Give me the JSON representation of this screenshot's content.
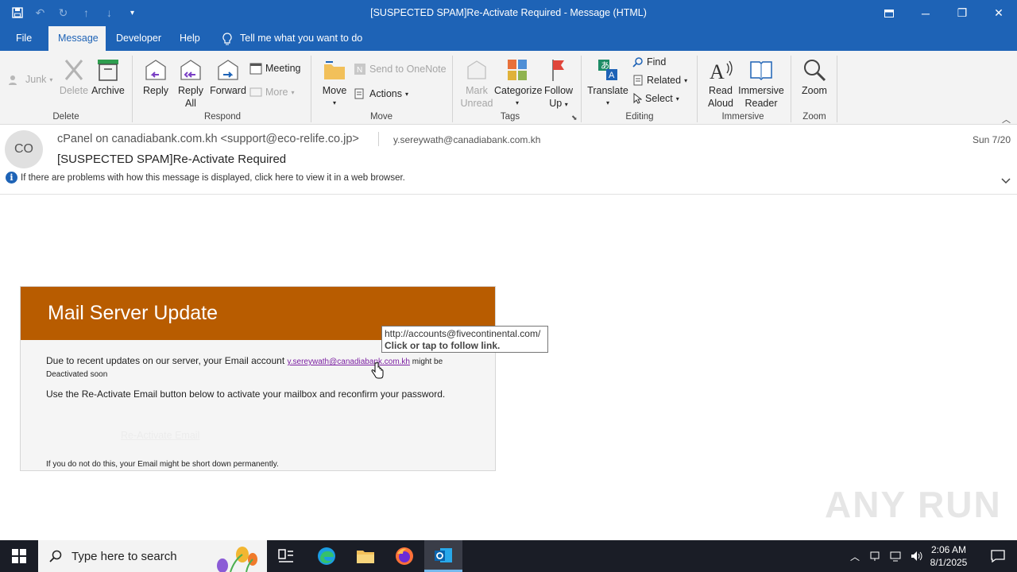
{
  "window": {
    "title": "[SUSPECTED SPAM]Re-Activate Required  -  Message (HTML)"
  },
  "menu": {
    "tabs": [
      "File",
      "Message",
      "Developer",
      "Help"
    ],
    "tell_me": "Tell me what you want to do"
  },
  "ribbon": {
    "junk": "Junk",
    "delete": "Delete",
    "archive": "Archive",
    "reply": "Reply",
    "reply_all_1": "Reply",
    "reply_all_2": "All",
    "forward": "Forward",
    "meeting": "Meeting",
    "more": "More",
    "move": "Move",
    "send_onenote": "Send to OneNote",
    "actions": "Actions",
    "mark_unread_1": "Mark",
    "mark_unread_2": "Unread",
    "categorize": "Categorize",
    "follow_up_1": "Follow",
    "follow_up_2": "Up",
    "translate": "Translate",
    "find": "Find",
    "related": "Related",
    "select": "Select",
    "read_aloud_1": "Read",
    "read_aloud_2": "Aloud",
    "immersive_reader_1": "Immersive",
    "immersive_reader_2": "Reader",
    "zoom": "Zoom",
    "groups": {
      "delete": "Delete",
      "respond": "Respond",
      "move": "Move",
      "tags": "Tags",
      "editing": "Editing",
      "immersive": "Immersive",
      "zoom": "Zoom"
    }
  },
  "message": {
    "avatar_initials": "CO",
    "from": "cPanel on canadiabank.com.kh <support@eco-relife.co.jp>",
    "to": "y.sereywath@canadiabank.com.kh",
    "date": "Sun 7/20",
    "subject": "[SUSPECTED SPAM]Re-Activate Required",
    "info_bar": "If there are problems with how this message is displayed, click here to view it in a web browser."
  },
  "email_body": {
    "banner": "Mail Server Update",
    "para1_start": "Due to recent updates on our server, your Email account ",
    "para1_link": "y.sereywath@canadiabank.com.kh",
    "para1_end": " might be",
    "para1_line2": "Deactivated soon",
    "para2": "Use the Re-Activate Email button below to activate your mailbox and reconfirm your password.",
    "button": "Re-Activate Email",
    "para3": "If you do not do this, your Email might be short down permanently."
  },
  "tooltip": {
    "url": "http://accounts@fivecontinental.com/",
    "hint": "Click or tap to follow link."
  },
  "watermark": "ANY RUN",
  "taskbar": {
    "search_placeholder": "Type here to search",
    "time": "2:06 AM",
    "date": "8/1/2025"
  }
}
